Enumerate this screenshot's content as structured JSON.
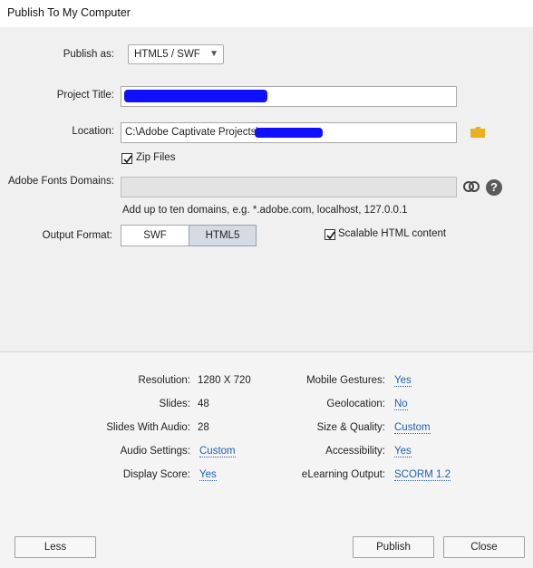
{
  "window": {
    "title": "Publish To My Computer"
  },
  "publish_as": {
    "label": "Publish as:",
    "value": "HTML5 / SWF"
  },
  "project_title": {
    "label": "Project Title:",
    "value": ""
  },
  "location": {
    "label": "Location:",
    "value": "C:\\Adobe Captivate Projects\\"
  },
  "zip_files": {
    "label": "Zip Files",
    "checked": true
  },
  "fonts_domains": {
    "label": "Adobe Fonts Domains:",
    "hint": "Add up to ten domains, e.g. *.adobe.com, localhost, 127.0.0.1"
  },
  "output_format": {
    "label": "Output Format:",
    "options": [
      "SWF",
      "HTML5"
    ],
    "selected": "HTML5"
  },
  "scalable": {
    "label": "Scalable HTML content",
    "checked": true
  },
  "summary_left": [
    {
      "label": "Resolution:",
      "value": "1280 X 720",
      "link": false
    },
    {
      "label": "Slides:",
      "value": "48",
      "link": false
    },
    {
      "label": "Slides With Audio:",
      "value": "28",
      "link": false
    },
    {
      "label": "Audio Settings:",
      "value": "Custom",
      "link": true
    },
    {
      "label": "Display Score:",
      "value": "Yes",
      "link": true
    }
  ],
  "summary_right": [
    {
      "label": "Mobile Gestures:",
      "value": "Yes",
      "link": true
    },
    {
      "label": "Geolocation:",
      "value": "No",
      "link": true
    },
    {
      "label": "Size & Quality:",
      "value": "Custom",
      "link": true
    },
    {
      "label": "Accessibility:",
      "value": "Yes",
      "link": true
    },
    {
      "label": "eLearning Output:",
      "value": "SCORM 1.2",
      "link": true
    }
  ],
  "buttons": {
    "less": "Less",
    "publish": "Publish",
    "close": "Close"
  },
  "colors": {
    "accent_link": "#1f5fb6",
    "redaction": "#1010ff",
    "folder": "#e8b21f"
  }
}
